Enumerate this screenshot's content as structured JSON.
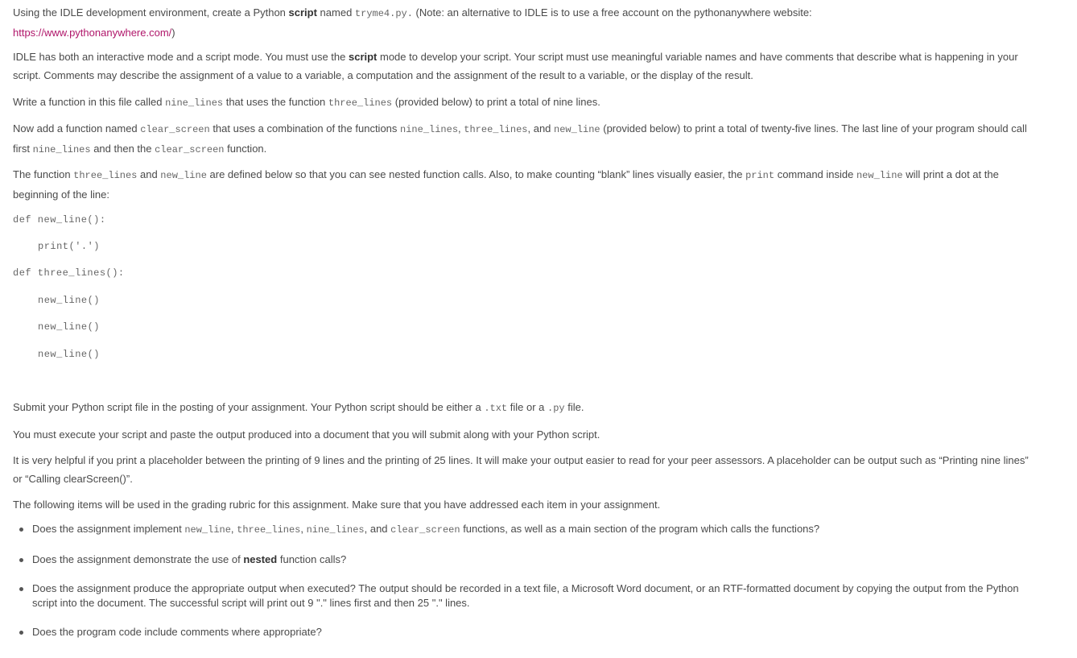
{
  "intro": {
    "t1": "Using the IDLE development environment, create a Python ",
    "b1": "script",
    "t2": " named ",
    "c1": "tryme4.py.",
    "t3": " (Note: an alternative to IDLE is to use a free account on the pythonanywhere website:",
    "link": "https://www.pythonanywhere.com/",
    "t4": ")"
  },
  "idle_para": {
    "t1": "IDLE has both an interactive mode and a script mode. You must use the ",
    "b1": "script",
    "t2": " mode to develop your script. Your script must use meaningful variable names and have comments that describe what is happening in your script. Comments may describe the assignment of a value to a variable, a computation and the assignment of the result to a variable, or the display of the result."
  },
  "nine_para": {
    "t1": "Write a function in this file called ",
    "c1": "nine_lines",
    "t2": " that uses the function ",
    "c2": "three_lines",
    "t3": " (provided below) to print a total of nine lines."
  },
  "clear_para": {
    "t1": "Now add a function named ",
    "c1": "clear_screen",
    "t2": " that uses a combination of the functions ",
    "c2": "nine_lines",
    "t3": ", ",
    "c3": "three_lines",
    "t4": ", and ",
    "c4": "new_line",
    "t5": " (provided below) to print a total of twenty-five lines. The last line of your program should call first ",
    "c5": "nine_lines",
    "t6": " and then the ",
    "c6": "clear_screen",
    "t7": " function."
  },
  "nested_para": {
    "t1": "The  function ",
    "c1": "three_lines",
    "t2": " and ",
    "c2": "new_line",
    "t3": " are defined below so that you can see nested function calls. Also, to make counting “blank” lines visually easier, the ",
    "c3": "print",
    "t4": " command inside ",
    "c4": "new_line",
    "t5": " will print a dot at the beginning of the line:"
  },
  "code_block": [
    "def new_line():",
    "print('.')",
    "def three_lines():",
    "new_line()",
    "new_line()",
    "new_line()"
  ],
  "submit_para": {
    "t1": "Submit your Python script file in the posting of your assignment. Your Python script should be either a ",
    "c1": ".txt",
    "t2": " file or a ",
    "c2": ".py",
    "t3": " file."
  },
  "execute_para": "You must execute your script and paste the output produced into a document that you will submit along with your Python script.",
  "placeholder_para": "It is very helpful if you print a placeholder between the printing of 9 lines and the printing of 25 lines. It will make your output easier to read for your peer assessors. A placeholder can be output such as “Printing nine lines” or “Calling clearScreen()”.",
  "rubric_intro": "The following items will be used in the grading rubric for this assignment. Make sure that you have addressed each item in your assignment.",
  "rubric": {
    "item1": {
      "t1": "Does the assignment implement ",
      "c1": "new_line",
      "t2": ", ",
      "c2": "three_lines",
      "t3": ", ",
      "c3": "nine_lines",
      "t4": ", and ",
      "c4": "clear_screen",
      "t5": " functions, as well as a main section of the program which calls the functions?"
    },
    "item2": {
      "t1": "Does the assignment demonstrate the use of ",
      "b1": "nested",
      "t2": " function calls?"
    },
    "item3": "Does the assignment produce the appropriate output when executed? The output should be recorded in a text file, a Microsoft Word document, or an RTF-formatted document by copying the output from the Python script into the document. The successful script will print out 9 \".\" lines first and then 25 \".\" lines.",
    "item4": "Does the program code include comments where appropriate?"
  }
}
